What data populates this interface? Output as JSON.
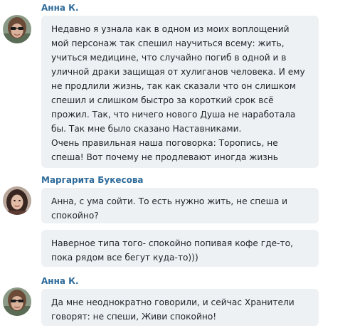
{
  "messages": [
    {
      "author": "Анна К.",
      "avatar": "avatar-woman-sunglasses",
      "bubbles": [
        [
          "Недавно я узнала как в одном из моих воплощений",
          "мой персонаж так спешил научиться всему: жить,",
          "учиться медицине, что случайно погиб в одной и в",
          "уличной драки защищая от хулиганов человека. И ему",
          "не продлили жизнь, так как сказали что он слишком",
          "спешил и слишком быстро за короткий срок всё",
          "прожил. Так,  что ничего нового Душа не наработала",
          "бы. Так мне было сказано Наставниками.",
          "Очень правильная наша поговорка: Торопись, не",
          "спеша! Вот почему не продлевают иногда жизнь"
        ]
      ]
    },
    {
      "author": "Маргарита Букесова",
      "avatar": "avatar-woman-dark-hair",
      "bubbles": [
        [
          "Анна, с ума сойти. То есть нужно жить, не спеша и",
          "спокойно?"
        ],
        [
          "Наверное типа того- спокойно попивая кофе где-то,",
          "пока рядом все бегут куда-то)))"
        ]
      ]
    },
    {
      "author": "Анна К.",
      "avatar": "avatar-woman-sunglasses",
      "bubbles": [
        [
          "Да мне неоднократно говорили, и сейчас Хранители",
          "говорят: не спеши, Живи спокойно!"
        ]
      ]
    }
  ],
  "colors": {
    "author": "#2f6b9a",
    "bubble_bg": "#eef1f4",
    "text": "#1f2327"
  }
}
